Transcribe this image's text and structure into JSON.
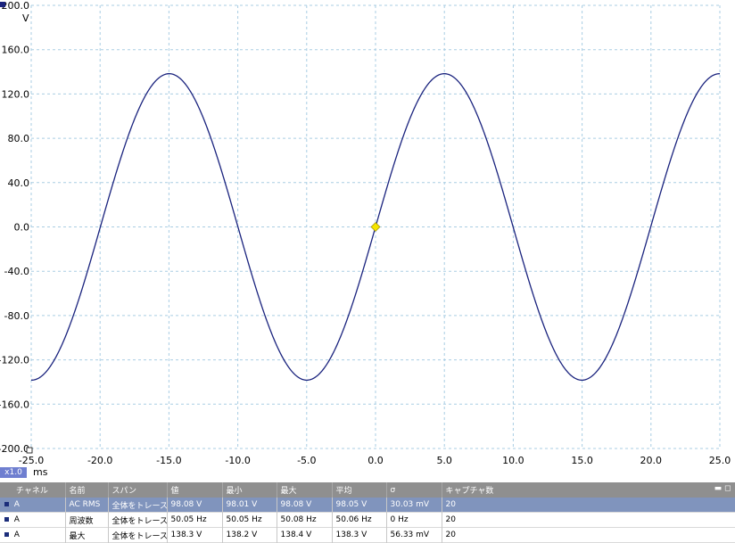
{
  "scope": {
    "y_unit": "V",
    "x_unit": "ms",
    "zoom_label": "x1.0",
    "trace_color": "#1a237e",
    "grid_color": "#a9cde3",
    "trigger_color": "#f5e400"
  },
  "chart_data": {
    "type": "line",
    "title": "",
    "xlabel": "ms",
    "ylabel": "V",
    "xlim": [
      -25,
      25
    ],
    "ylim": [
      -200,
      200
    ],
    "x_ticks": [
      "-25.0",
      "-20.0",
      "-15.0",
      "-10.0",
      "-5.0",
      "0.0",
      "5.0",
      "10.0",
      "15.0",
      "20.0",
      "25.0"
    ],
    "y_ticks": [
      "200.0",
      "160.0",
      "120.0",
      "80.0",
      "40.0",
      "0.0",
      "-40.0",
      "-80.0",
      "-120.0",
      "-160.0",
      "-200.0"
    ],
    "grid": true,
    "series": [
      {
        "amplitude": 138.3,
        "frequency_hz": 50.05,
        "phase_zero_ms": 0
      }
    ],
    "trigger_point": {
      "x": 0,
      "y": 0
    }
  },
  "table": {
    "headers": [
      "チャネル",
      "名前",
      "スパン",
      "値",
      "最小",
      "最大",
      "平均",
      "σ",
      "キャプチャ数"
    ],
    "header_controls": "▬ ◻",
    "rows": [
      [
        "A",
        "AC RMS",
        "全体をトレース",
        "98.08 V",
        "98.01 V",
        "98.08 V",
        "98.05 V",
        "30.03 mV",
        "20"
      ],
      [
        "A",
        "周波数",
        "全体をトレース",
        "50.05 Hz",
        "50.05 Hz",
        "50.08 Hz",
        "50.06 Hz",
        "0 Hz",
        "20"
      ],
      [
        "A",
        "最大",
        "全体をトレース",
        "138.3 V",
        "138.2 V",
        "138.4 V",
        "138.3 V",
        "56.33 mV",
        "20"
      ]
    ]
  }
}
